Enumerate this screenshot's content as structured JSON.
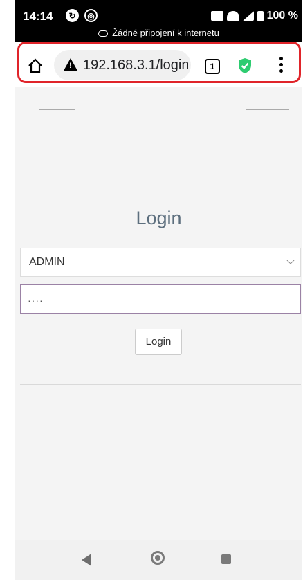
{
  "status_bar": {
    "time": "14:14",
    "battery": "100 %",
    "offline_notice": "Žádné připojení k internetu"
  },
  "browser": {
    "url": "192.168.3.1/login",
    "tab_count": "1",
    "highlight_color": "#e0242a"
  },
  "page": {
    "title": "Login",
    "user_select": {
      "selected": "ADMIN"
    },
    "password": {
      "value": "····"
    },
    "login_button": "Login"
  },
  "colors": {
    "title": "#5d6f7e",
    "shield": "#2ecc71",
    "password_border": "#9b82a5"
  }
}
